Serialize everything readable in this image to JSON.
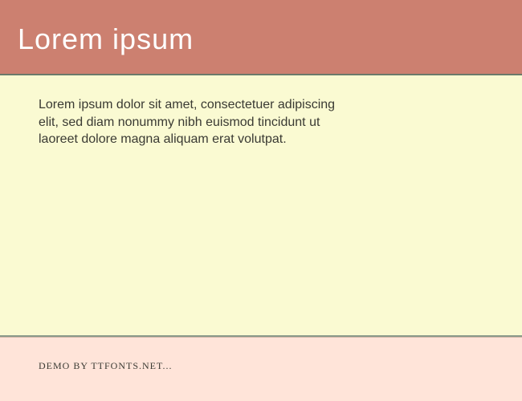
{
  "header": {
    "title": "Lorem ipsum"
  },
  "content": {
    "paragraph": "Lorem ipsum dolor sit amet, consectetuer adipiscing elit, sed diam nonummy nibh euismod tincidunt ut laoreet dolore magna aliquam erat volutpat."
  },
  "footer": {
    "text": "DEMO BY TTFONTS.NET..."
  }
}
